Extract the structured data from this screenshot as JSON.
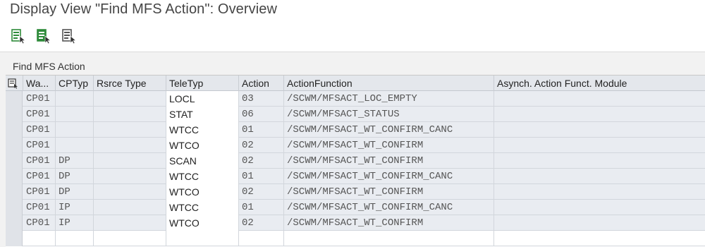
{
  "window": {
    "title": "Display View \"Find MFS Action\": Overview"
  },
  "toolbar": {
    "buttons": [
      {
        "icon": "detail-view-icon",
        "color": "#2e8b3a"
      },
      {
        "icon": "select-all-icon",
        "color": "#2e8b3a"
      },
      {
        "icon": "deselect-all-icon",
        "color": "#555555"
      }
    ]
  },
  "grid": {
    "title": "Find MFS Action",
    "columns": [
      "Wa...",
      "CPTyp",
      "Rsrce Type",
      "TeleTyp",
      "Action",
      "ActionFunction",
      "Asynch. Action Funct. Module"
    ],
    "rows": [
      {
        "wa": "CP01",
        "cptyp": "",
        "rsrce": "",
        "tele": "LOCL",
        "action": "03",
        "func": "/SCWM/MFSACT_LOC_EMPTY",
        "async": ""
      },
      {
        "wa": "CP01",
        "cptyp": "",
        "rsrce": "",
        "tele": "STAT",
        "action": "06",
        "func": "/SCWM/MFSACT_STATUS",
        "async": ""
      },
      {
        "wa": "CP01",
        "cptyp": "",
        "rsrce": "",
        "tele": "WTCC",
        "action": "01",
        "func": "/SCWM/MFSACT_WT_CONFIRM_CANC",
        "async": ""
      },
      {
        "wa": "CP01",
        "cptyp": "",
        "rsrce": "",
        "tele": "WTCO",
        "action": "02",
        "func": "/SCWM/MFSACT_WT_CONFIRM",
        "async": ""
      },
      {
        "wa": "CP01",
        "cptyp": "DP",
        "rsrce": "",
        "tele": "SCAN",
        "action": "02",
        "func": "/SCWM/MFSACT_WT_CONFIRM",
        "async": ""
      },
      {
        "wa": "CP01",
        "cptyp": "DP",
        "rsrce": "",
        "tele": "WTCC",
        "action": "01",
        "func": "/SCWM/MFSACT_WT_CONFIRM_CANC",
        "async": ""
      },
      {
        "wa": "CP01",
        "cptyp": "DP",
        "rsrce": "",
        "tele": "WTCO",
        "action": "02",
        "func": "/SCWM/MFSACT_WT_CONFIRM",
        "async": ""
      },
      {
        "wa": "CP01",
        "cptyp": "IP",
        "rsrce": "",
        "tele": "WTCC",
        "action": "01",
        "func": "/SCWM/MFSACT_WT_CONFIRM_CANC",
        "async": ""
      },
      {
        "wa": "CP01",
        "cptyp": "IP",
        "rsrce": "",
        "tele": "WTCO",
        "action": "02",
        "func": "/SCWM/MFSACT_WT_CONFIRM",
        "async": ""
      }
    ]
  }
}
